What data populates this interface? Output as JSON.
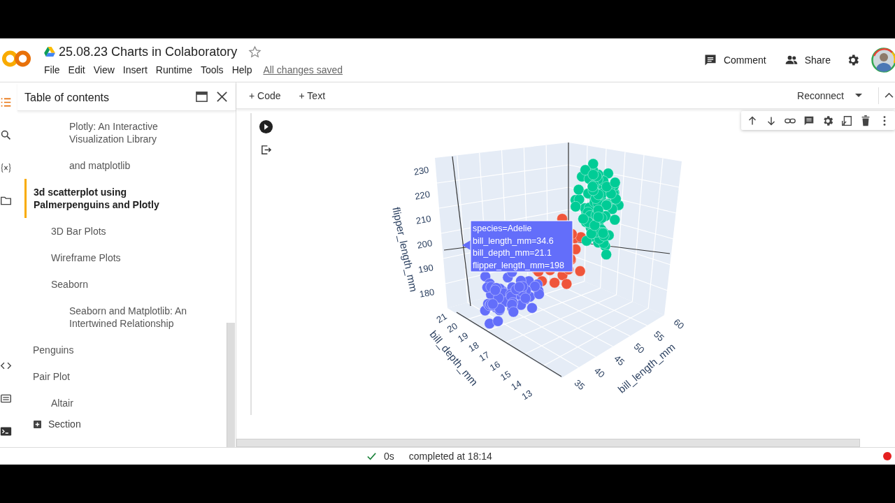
{
  "notebook": {
    "title": "25.08.23 Charts in Colaboratory",
    "menu": [
      "File",
      "Edit",
      "View",
      "Insert",
      "Runtime",
      "Tools",
      "Help"
    ],
    "save_status": "All changes saved"
  },
  "header_actions": {
    "comment": "Comment",
    "share": "Share"
  },
  "toolbar": {
    "add_code": "+ Code",
    "add_text": "+ Text",
    "connect": "Reconnect"
  },
  "sidebar": {
    "title": "Table of contents",
    "add_section": "Section"
  },
  "toc": [
    {
      "children": [
        {
          "children": [
            {
              "title": "Plotly: An Interactive Visualization Library",
              "selected": false
            },
            {
              "title": "and matplotlib",
              "selected": false
            }
          ]
        }
      ]
    },
    {
      "title": "3d scatterplot using Palmerpenguins and Plotly",
      "selected": true,
      "children": [
        {
          "title": "3D Bar Plots",
          "selected": false
        },
        {
          "title": "Wireframe Plots",
          "selected": false
        },
        {
          "title": "Seaborn",
          "selected": false,
          "children": [
            {
              "title": "Seaborn and Matplotlib: An Intertwined Relationship",
              "selected": false
            }
          ]
        }
      ]
    },
    {
      "title": "Penguins",
      "selected": false
    },
    {
      "title": "Pair Plot",
      "selected": false,
      "children": [
        {
          "title": "Altair",
          "selected": false
        }
      ]
    }
  ],
  "plot": {
    "axes": [
      {
        "title": "flipper_length_mm",
        "ticks": [
          "230",
          "220",
          "210",
          "200",
          "190",
          "180"
        ]
      },
      {
        "title": "bill_depth_mm",
        "ticks": [
          "21",
          "20",
          "19",
          "18",
          "17",
          "16",
          "15",
          "14",
          "13"
        ]
      },
      {
        "title": "bill_length_mm",
        "ticks": [
          "35",
          "40",
          "45",
          "50",
          "55",
          "60"
        ]
      }
    ],
    "clusters": [
      {
        "color": "#ef553b"
      },
      {
        "color": "#00cc96"
      },
      {
        "color": "#636efa"
      }
    ],
    "tooltip": [
      "species=Adelie",
      "bill_length_mm=34.6",
      "bill_depth_mm=21.1",
      "flipper_length_mm=198"
    ]
  },
  "status": {
    "duration": "0s",
    "message": "completed at 18:14"
  }
}
